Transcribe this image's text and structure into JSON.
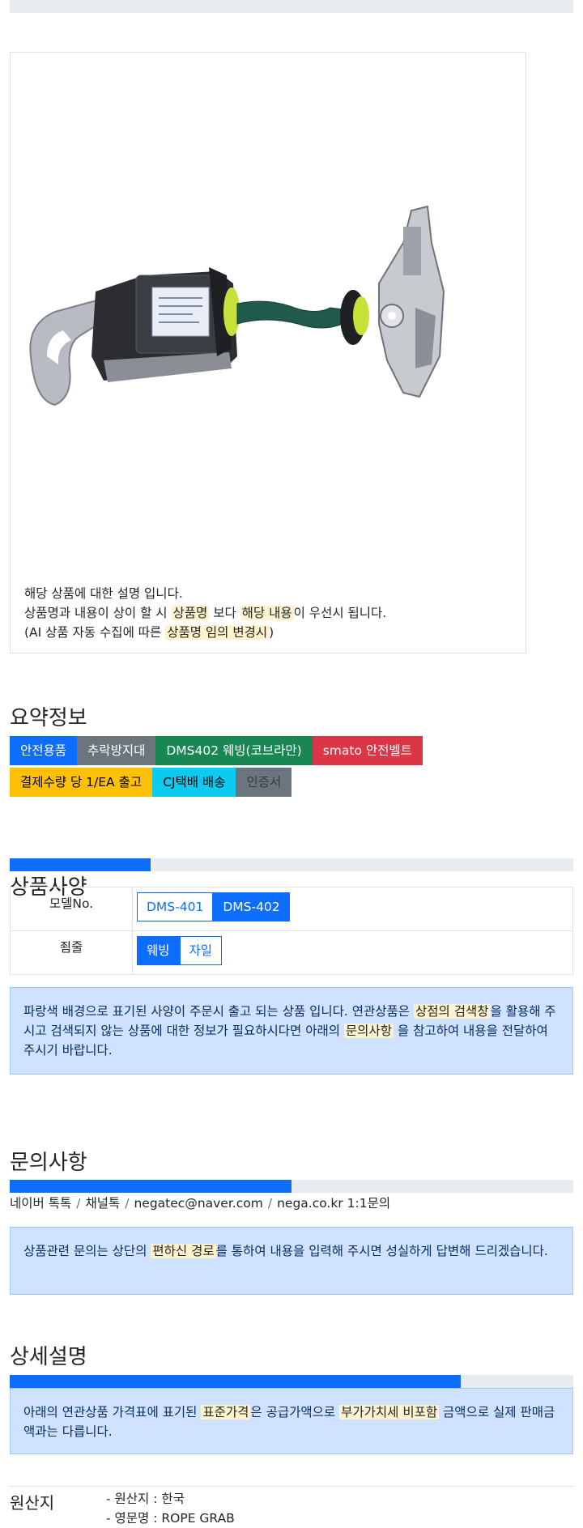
{
  "product_image": {
    "alt": "product-photo"
  },
  "description": {
    "line1": "해당 상품에 대한 설명 입니다.",
    "line2_a": "상품명과 내용이 상이 할 시 ",
    "line2_mark1": "상품명",
    "line2_b": " 보다 ",
    "line2_mark2": "해당 내용",
    "line2_c": "이 우선시 됩니다.",
    "line3_a": "(AI 상품 자동 수집에 따른 ",
    "line3_mark": "상품명 임의 변경시",
    "line3_b": ")"
  },
  "summary": {
    "title": "요약정보",
    "badges_row1": [
      {
        "label": "안전용품",
        "color": "#0d6efd"
      },
      {
        "label": "추락방지대",
        "color": "#6c757d"
      },
      {
        "label": "DMS402 웨빙(코브라만)",
        "color": "#198754"
      },
      {
        "label": "smato 안전벨트",
        "color": "#dc3545"
      }
    ],
    "badges_row2": [
      {
        "label": "결제수량 당 1/EA 출고",
        "color": "#ffc107"
      },
      {
        "label": "CJ택배 배송",
        "color": "#0dcaf0"
      },
      {
        "label": "인증서",
        "color": "#6c757d"
      }
    ]
  },
  "spec": {
    "progress_fraction": 0.25,
    "title": "상품사양",
    "rows": [
      {
        "header": "모델No.",
        "options": [
          "DMS-401",
          "DMS-402"
        ],
        "selected": "DMS-402"
      },
      {
        "header": "죔줄",
        "options": [
          "웨빙",
          "자일"
        ],
        "selected": "웨빙"
      }
    ],
    "notice_a": "파랑색 배경으로 표기된 사양이 주문시 출고 되는 상품 입니다. 연관상품은 ",
    "notice_mark1": "상점의 검색창",
    "notice_b": "을 활용해 주시고 검색되지 않는 상품에 대한 정보가 필요하시다면 아래의 ",
    "notice_mark2": "문의사항",
    "notice_c": " 을 참고하여 내용을 전달하여 주시기 바랍니다."
  },
  "inquiry": {
    "title": "문의사항",
    "progress_fraction": 0.5,
    "links": [
      "네이버 톡톡",
      "채널톡",
      "negatec@naver.com",
      "nega.co.kr 1:1문의"
    ],
    "separator": "/",
    "notice_a": "상품관련 문의는 상단의 ",
    "notice_mark": "편하신 경로",
    "notice_b": "를 통하여 내용을 입력해 주시면 성실하게 답변해 드리겠습니다."
  },
  "detail": {
    "title": "상세설명",
    "progress_fraction": 0.8,
    "notice_a": "아래의 연관상품 가격표에 표기된 ",
    "notice_mark1": "표준가격",
    "notice_b": "은 공급가액으로 ",
    "notice_mark2": "부가가치세 비포함",
    "notice_c": " 금액으로 실제 판매금액과는 다릅니다."
  },
  "origin": {
    "label": "원산지",
    "values": [
      "- 원산지 : 한국",
      "- 영문명 : ROPE GRAB"
    ]
  }
}
